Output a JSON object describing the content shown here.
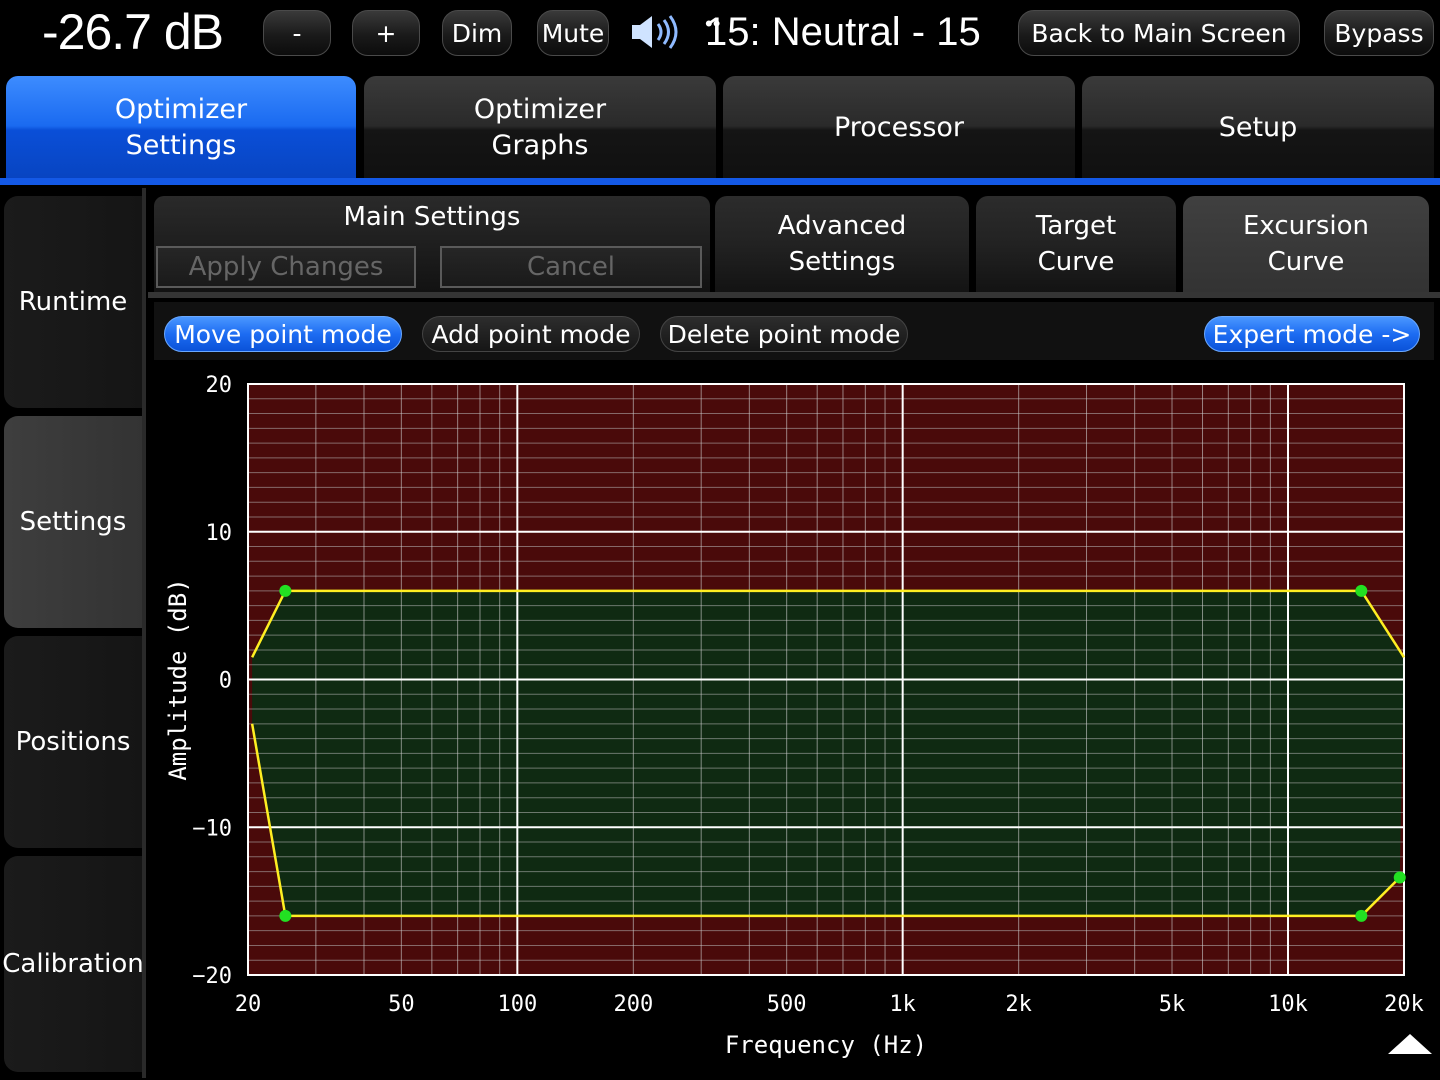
{
  "topbar": {
    "volume": "-26.7 dB",
    "minus_label": "-",
    "plus_label": "+",
    "dim_label": "Dim",
    "mute_label": "Mute",
    "preset_dots": "••",
    "preset": "15: Neutral - 15",
    "back_label": "Back to Main Screen",
    "bypass_label": "Bypass",
    "speaker_icon": "speaker-volume-icon"
  },
  "main_tabs": [
    {
      "line1": "Optimizer",
      "line2": "Settings",
      "active": true
    },
    {
      "line1": "Optimizer",
      "line2": "Graphs",
      "active": false
    },
    {
      "line1": "Processor",
      "line2": "",
      "active": false
    },
    {
      "line1": "Setup",
      "line2": "",
      "active": false
    }
  ],
  "side_tabs": [
    {
      "label": "Runtime",
      "active": false
    },
    {
      "label": "Settings",
      "active": true
    },
    {
      "label": "Positions",
      "active": false
    },
    {
      "label": "Calibration",
      "active": false
    }
  ],
  "main_settings": {
    "title": "Main Settings",
    "apply_label": "Apply Changes",
    "cancel_label": "Cancel"
  },
  "sub_tabs": [
    {
      "line1": "Advanced",
      "line2": "Settings",
      "active": false
    },
    {
      "line1": "Target",
      "line2": "Curve",
      "active": false
    },
    {
      "line1": "Excursion",
      "line2": "Curve",
      "active": true
    }
  ],
  "modes": {
    "move_label": "Move point mode",
    "add_label": "Add point mode",
    "delete_label": "Delete point mode",
    "expert_label": "Expert mode ->"
  },
  "colors": {
    "accent_blue": "#1459e6",
    "outside_region": "#4a0a0a",
    "inside_region": "#0f2a12",
    "curve": "#ffee22",
    "point": "#22e022"
  },
  "chart_data": {
    "type": "line",
    "xlabel": "Frequency (Hz)",
    "ylabel": "Amplitude (dB)",
    "xscale": "log",
    "xlim": [
      20,
      20000
    ],
    "ylim": [
      -20,
      20
    ],
    "xticks": [
      {
        "v": 20,
        "label": "20"
      },
      {
        "v": 50,
        "label": "50"
      },
      {
        "v": 100,
        "label": "100"
      },
      {
        "v": 200,
        "label": "200"
      },
      {
        "v": 500,
        "label": "500"
      },
      {
        "v": 1000,
        "label": "1k"
      },
      {
        "v": 2000,
        "label": "2k"
      },
      {
        "v": 5000,
        "label": "5k"
      },
      {
        "v": 10000,
        "label": "10k"
      },
      {
        "v": 20000,
        "label": "20k"
      }
    ],
    "yticks": [
      {
        "v": 20,
        "label": "20"
      },
      {
        "v": 10,
        "label": "10"
      },
      {
        "v": 0,
        "label": "0"
      },
      {
        "v": -10,
        "label": "−10"
      },
      {
        "v": -20,
        "label": "−20"
      }
    ],
    "grid": true,
    "series": [
      {
        "role": "upper",
        "points": [
          [
            20.5,
            1.5
          ],
          [
            25,
            6
          ],
          [
            15500,
            6
          ],
          [
            20000,
            1.5
          ]
        ],
        "control_points": [
          [
            25,
            6
          ],
          [
            15500,
            6
          ]
        ]
      },
      {
        "role": "lower",
        "points": [
          [
            20.5,
            -3
          ],
          [
            25,
            -16
          ],
          [
            15500,
            -16
          ],
          [
            19500,
            -13.4
          ]
        ],
        "control_points": [
          [
            25,
            -16
          ],
          [
            15500,
            -16
          ],
          [
            19500,
            -13.4
          ]
        ]
      }
    ]
  }
}
